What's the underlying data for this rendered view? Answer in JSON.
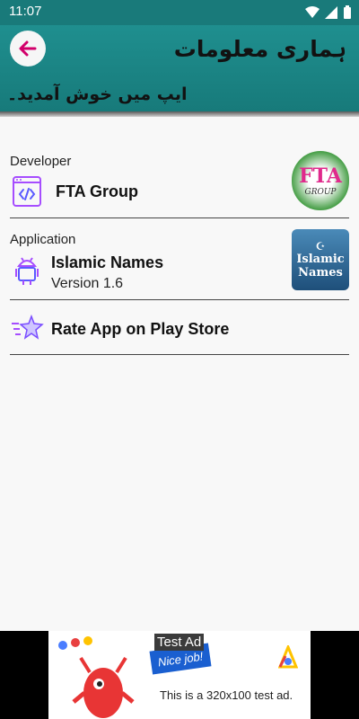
{
  "status_bar": {
    "time": "11:07"
  },
  "header": {
    "title": "ہماری معلومات",
    "welcome": "ایپ میں خوش آمدید۔"
  },
  "developer": {
    "section_label": "Developer",
    "name": "FTA Group",
    "logo_text": "FTA",
    "logo_sub": "GROUP"
  },
  "application": {
    "section_label": "Application",
    "name": "Islamic Names",
    "version": "Version 1.6",
    "logo_line1": "Islamic",
    "logo_line2": "Names"
  },
  "rate": {
    "label": "Rate App on Play Store"
  },
  "ad": {
    "label": "Test Ad",
    "badge": "Nice job!",
    "text": "This is a 320x100 test ad."
  },
  "colors": {
    "header": "#1f8f8f",
    "accent_icon": "#a64dff",
    "back_arrow": "#d2006b"
  },
  "icons": [
    "back-arrow-icon",
    "wifi-icon",
    "signal-icon",
    "battery-icon",
    "code-icon",
    "android-icon",
    "star-icon"
  ]
}
